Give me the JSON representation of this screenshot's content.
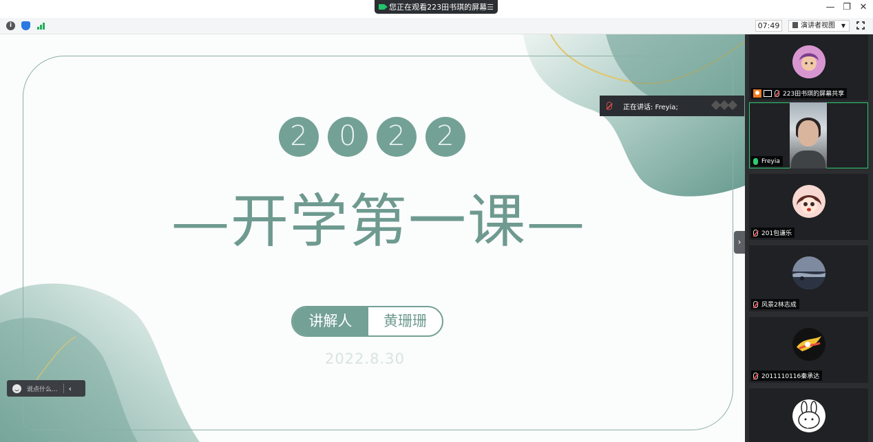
{
  "window": {
    "share_banner": "您正在观看223田书琪的屏幕",
    "menu_glyph": "☰",
    "minimize": "—",
    "restore": "❐",
    "close": "✕"
  },
  "toolbar": {
    "time": "07:49",
    "view_label": "演讲者视图",
    "info_glyph": "i"
  },
  "slide": {
    "year_digits": [
      "2",
      "0",
      "2",
      "2"
    ],
    "headline": "—开学第一课—",
    "presenter_label": "讲解人",
    "presenter_name": "黄珊珊",
    "date": "2022.8.30"
  },
  "overlay": {
    "speaking_text": "正在讲话: Freyia;",
    "chat_placeholder": "说点什么...",
    "chat_chevron": "‹",
    "collapse_chevron": "›"
  },
  "participants": [
    {
      "name": "223田书琪的屏幕共享",
      "mic": "muted",
      "host": true,
      "sharing": true
    },
    {
      "name": "Freyia",
      "mic": "on",
      "video": true
    },
    {
      "name": "201包谦乐",
      "mic": "muted"
    },
    {
      "name": "风景2林志成",
      "mic": "muted"
    },
    {
      "name": "2011110116秦承达",
      "mic": "muted"
    },
    {
      "name": "",
      "mic": "muted"
    }
  ],
  "colors": {
    "accent_green": "#73a195",
    "sidebar_bg": "#2b2d31",
    "active_border": "#2ecc71"
  }
}
